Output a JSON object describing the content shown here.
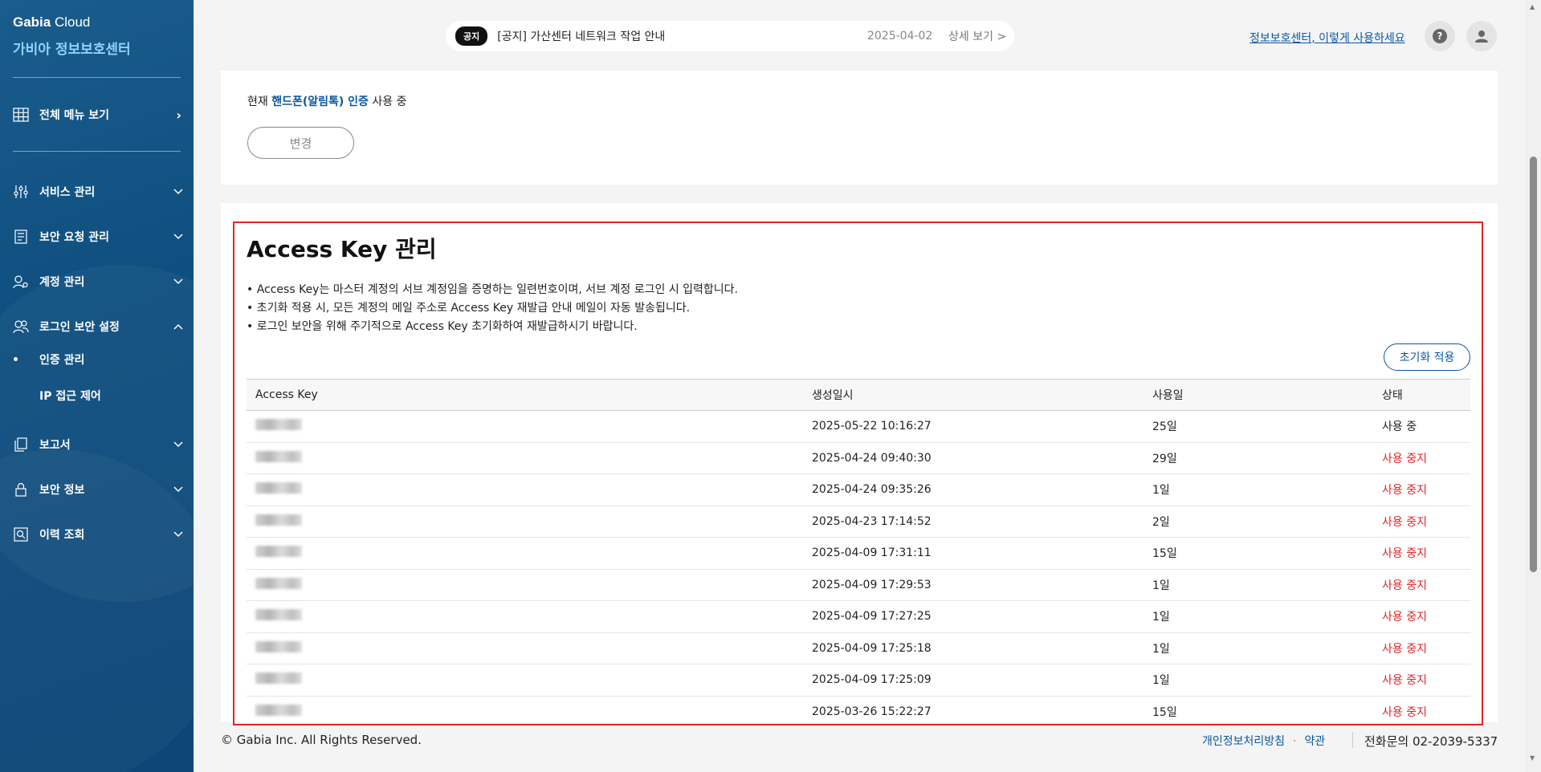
{
  "sidebar": {
    "brand_top_bold": "Gabia",
    "brand_top_rest": " Cloud",
    "brand_main": "가비아 정보보호센터",
    "all_menu": "전체 메뉴 보기",
    "items": [
      {
        "label": "서비스 관리",
        "icon": "sliders-icon"
      },
      {
        "label": "보안 요청 관리",
        "icon": "document-icon"
      },
      {
        "label": "계정 관리",
        "icon": "user-gear-icon"
      },
      {
        "label": "로그인 보안 설정",
        "icon": "users-icon"
      },
      {
        "label": "보고서",
        "icon": "copy-icon"
      },
      {
        "label": "보안 정보",
        "icon": "lock-icon"
      },
      {
        "label": "이력 조회",
        "icon": "search-doc-icon"
      }
    ],
    "sub_items": [
      {
        "label": "인증 관리",
        "active": true
      },
      {
        "label": "IP 접근 제어",
        "active": false
      }
    ]
  },
  "notice": {
    "badge": "공지",
    "title": "[공지] 가산센터 네트워크 작업 안내",
    "date": "2025-04-02",
    "more": "상세 보기 >"
  },
  "header": {
    "guide_link": "정보보호센터, 이렇게 사용하세요",
    "help_icon": "?"
  },
  "auth": {
    "prefix": "현재",
    "method": "핸드폰(알림톡) 인증",
    "suffix": "사용 중",
    "change_button": "변경"
  },
  "access_key": {
    "title": "Access Key 관리",
    "descriptions": [
      "• Access Key는 마스터 계정의 서브 계정임을 증명하는 일련번호이며, 서브 계정 로그인 시 입력합니다.",
      "• 초기화 적용 시, 모든 계정의 메일 주소로 Access Key 재발급 안내 메일이 자동 발송됩니다.",
      "• 로그인 보안을 위해 주기적으로 Access Key 초기화하여 재발급하시기 바랍니다."
    ],
    "reset_button": "초기화 적용",
    "columns": [
      "Access Key",
      "생성일시",
      "사용일",
      "상태"
    ],
    "rows": [
      {
        "created": "2025-05-22 10:16:27",
        "days": "25일",
        "status": "사용 중",
        "active": true
      },
      {
        "created": "2025-04-24 09:40:30",
        "days": "29일",
        "status": "사용 중지",
        "active": false
      },
      {
        "created": "2025-04-24 09:35:26",
        "days": "1일",
        "status": "사용 중지",
        "active": false
      },
      {
        "created": "2025-04-23 17:14:52",
        "days": "2일",
        "status": "사용 중지",
        "active": false
      },
      {
        "created": "2025-04-09 17:31:11",
        "days": "15일",
        "status": "사용 중지",
        "active": false
      },
      {
        "created": "2025-04-09 17:29:53",
        "days": "1일",
        "status": "사용 중지",
        "active": false
      },
      {
        "created": "2025-04-09 17:27:25",
        "days": "1일",
        "status": "사용 중지",
        "active": false
      },
      {
        "created": "2025-04-09 17:25:18",
        "days": "1일",
        "status": "사용 중지",
        "active": false
      },
      {
        "created": "2025-04-09 17:25:09",
        "days": "1일",
        "status": "사용 중지",
        "active": false
      },
      {
        "created": "2025-03-26 15:22:27",
        "days": "15일",
        "status": "사용 중지",
        "active": false
      }
    ]
  },
  "footer": {
    "copyright": "© Gabia Inc. All Rights Reserved.",
    "privacy": "개인정보처리방침",
    "terms": "약관",
    "phone": "전화문의 02-2039-5337"
  },
  "colors": {
    "sidebar_bg": "#0f4f80",
    "brand_accent": "#8fd3ff",
    "link_blue": "#0b57a4",
    "stop_red": "#e32424"
  }
}
